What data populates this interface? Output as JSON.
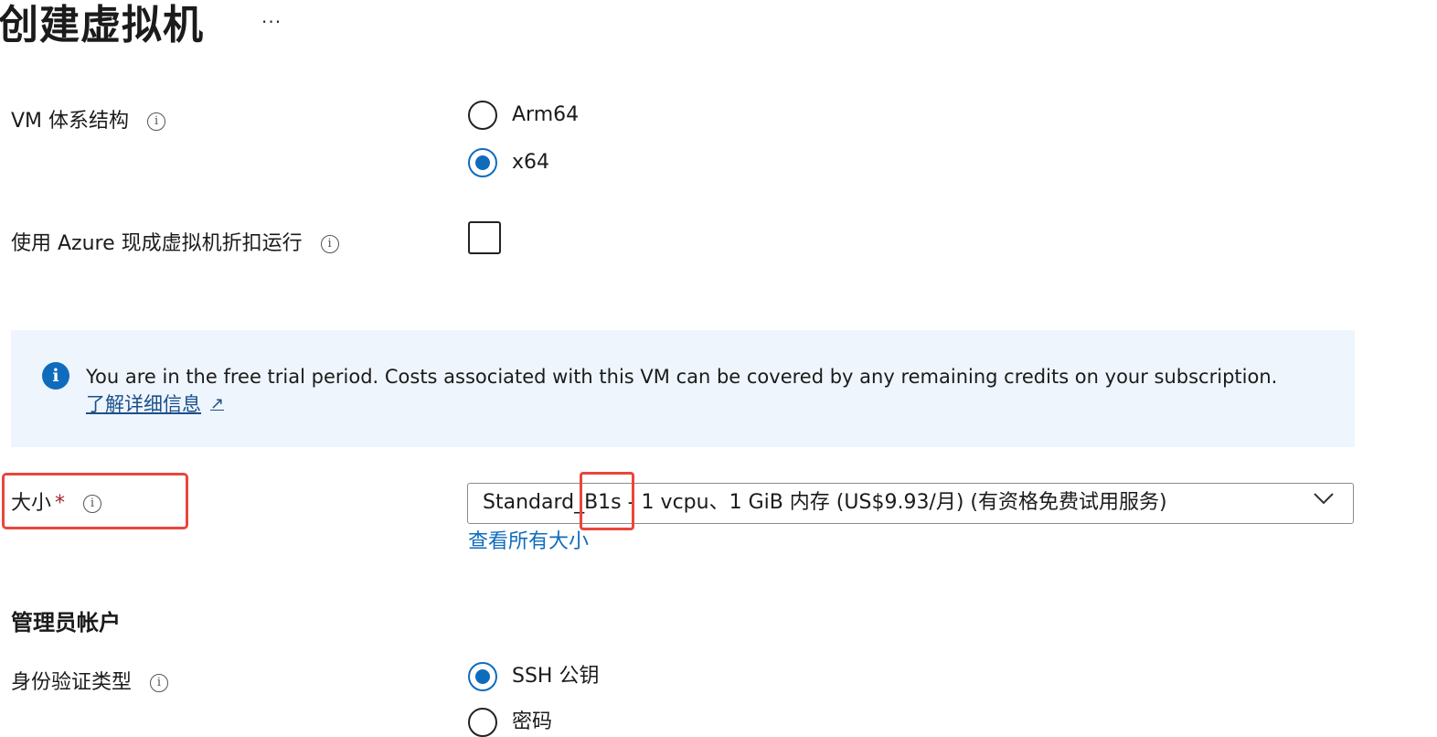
{
  "page": {
    "title": "创建虚拟机",
    "more_label": "···"
  },
  "vm_arch": {
    "label": "VM 体系结构",
    "info_glyph": "i",
    "options": [
      {
        "label": "Arm64",
        "selected": false
      },
      {
        "label": "x64",
        "selected": true
      }
    ]
  },
  "discount": {
    "label": "使用 Azure 现成虚拟机折扣运行",
    "info_glyph": "i",
    "checked": false
  },
  "info_banner": {
    "icon_glyph": "i",
    "message": "You are in the free trial period. Costs associated with this VM can be covered by any remaining credits on your subscription.",
    "link_text": "了解详细信息",
    "link_icon": "external-link-icon",
    "ext_glyph": "↗"
  },
  "size": {
    "label": "大小",
    "required_marker": "*",
    "info_glyph": "i",
    "selected_value": "Standard_B1s - 1 vcpu、1 GiB 内存 (US$9.93/月) (有资格免费试用服务)",
    "see_all_link": "查看所有大小"
  },
  "admin_section": {
    "heading": "管理员帐户"
  },
  "auth_type": {
    "label": "身份验证类型",
    "info_glyph": "i",
    "options": [
      {
        "label": "SSH 公钥",
        "selected": true
      },
      {
        "label": "密码",
        "selected": false
      }
    ]
  },
  "colors": {
    "accent": "#0f6cbd",
    "highlight": "#e8473b",
    "info_bg": "#eef5fd",
    "required": "#a4262c"
  }
}
